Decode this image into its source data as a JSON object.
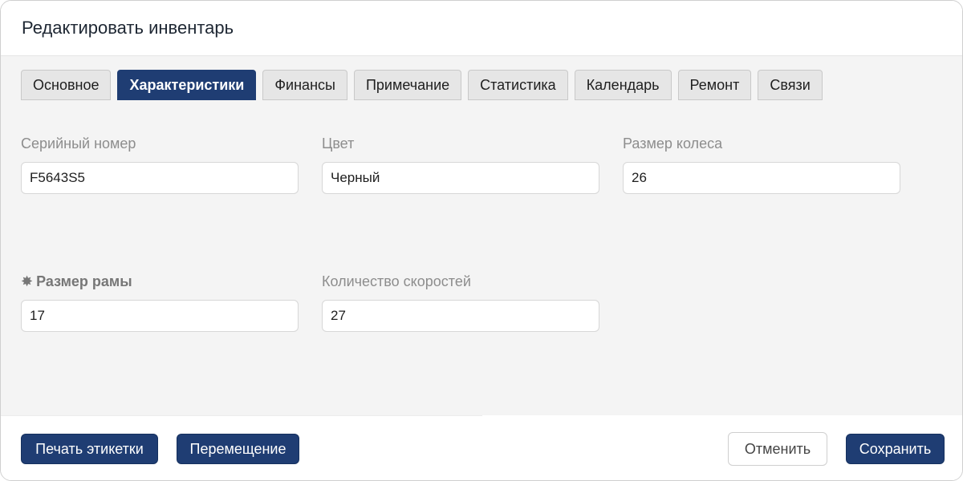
{
  "dialog": {
    "title": "Редактировать инвентарь"
  },
  "tabs": [
    {
      "label": "Основное",
      "active": false
    },
    {
      "label": "Характеристики",
      "active": true
    },
    {
      "label": "Финансы",
      "active": false
    },
    {
      "label": "Примечание",
      "active": false
    },
    {
      "label": "Статистика",
      "active": false
    },
    {
      "label": "Календарь",
      "active": false
    },
    {
      "label": "Ремонт",
      "active": false
    },
    {
      "label": "Связи",
      "active": false
    }
  ],
  "fields": {
    "serial_number": {
      "label": "Серийный номер",
      "value": "F5643S5"
    },
    "color": {
      "label": "Цвет",
      "value": "Черный"
    },
    "wheel_size": {
      "label": "Размер колеса",
      "value": "26"
    },
    "frame_size": {
      "label": "Размер рамы",
      "value": "17",
      "required_mark": "✸"
    },
    "speed_count": {
      "label": "Количество скоростей",
      "value": "27"
    }
  },
  "footer": {
    "print_label": "Печать этикетки",
    "move_label": "Перемещение",
    "cancel_label": "Отменить",
    "save_label": "Сохранить"
  },
  "colors": {
    "accent": "#1f3d73",
    "body_bg": "#f4f4f4",
    "tab_bg": "#e6e6e6"
  }
}
